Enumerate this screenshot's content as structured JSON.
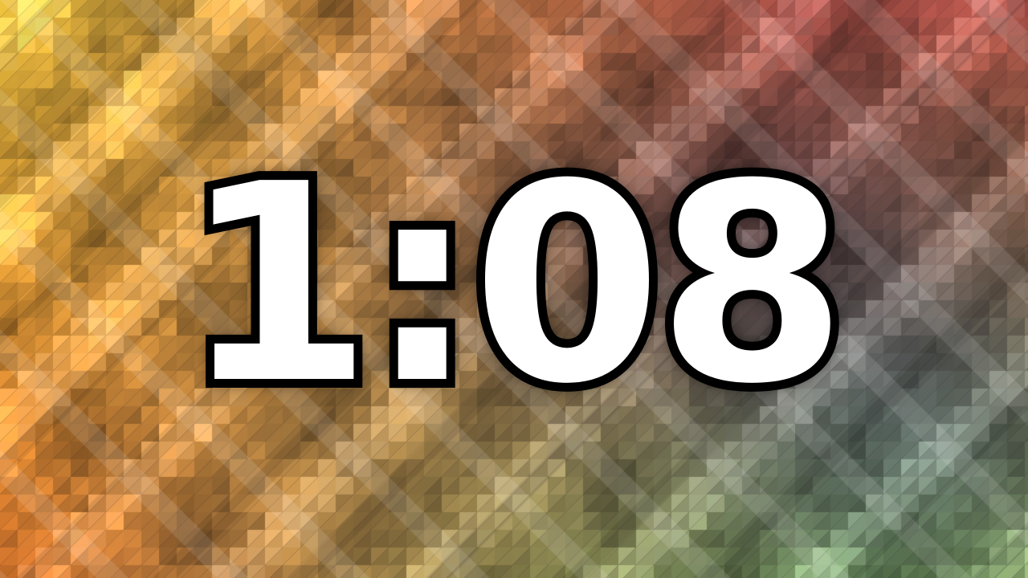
{
  "timer": {
    "display": "1:08"
  },
  "background": {
    "style": "diagonal-plaid-mosaic",
    "colors": {
      "warm_gold": "#e2b93b",
      "orange": "#e07a2e",
      "magenta": "#9c3a5a",
      "teal": "#3f8c86",
      "blue_slate": "#3c5a86",
      "olive_green": "#8fae4a",
      "deep_plum": "#3c2238"
    }
  },
  "text_colors": {
    "fill": "#ffffff",
    "outline": "#000000"
  }
}
